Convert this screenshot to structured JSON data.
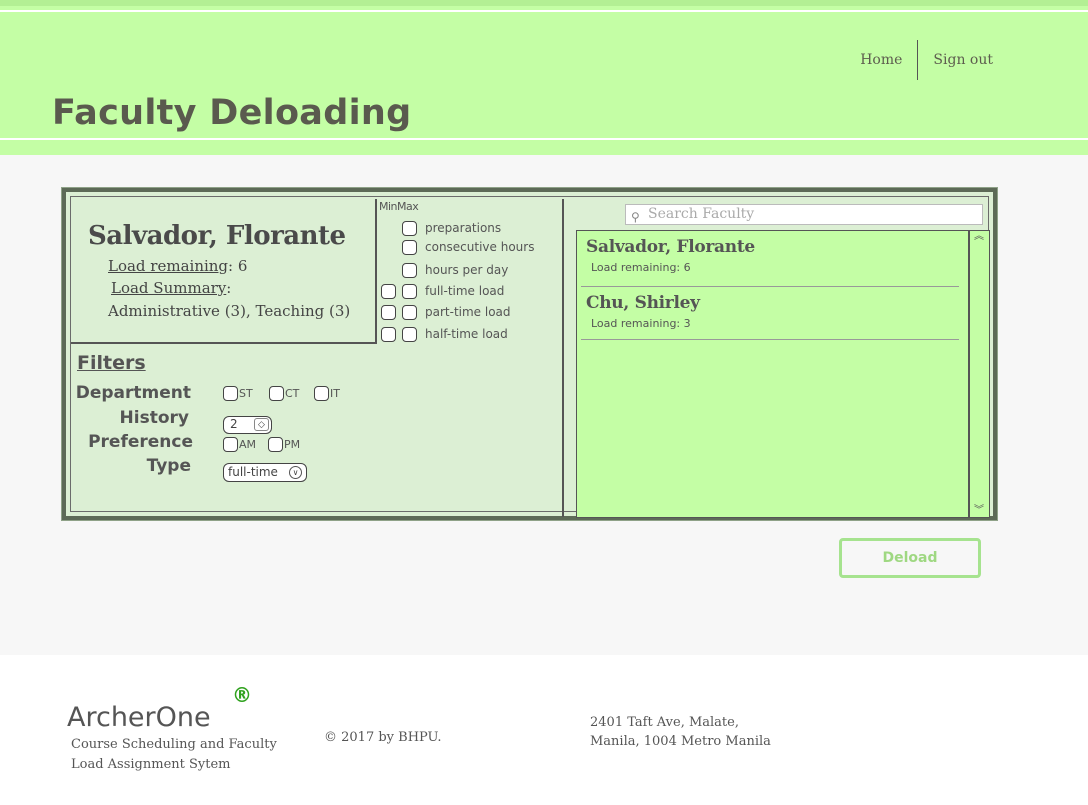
{
  "header": {
    "title": "Faculty Deloading",
    "nav": {
      "home": "Home",
      "signout": "Sign out"
    }
  },
  "faculty": {
    "name": "Salvador, Florante",
    "load_remaining_label": "Load remaining",
    "load_remaining_value": ": 6",
    "load_summary_label": "Load Summary",
    "load_summary_colon": ":",
    "load_summary_value": "Administrative (3), Teaching (3)"
  },
  "constraints": {
    "min_label": "Min",
    "max_label": "Max",
    "items": [
      {
        "label": "preparations",
        "has_min": false
      },
      {
        "label": "consecutive hours",
        "has_min": false
      },
      {
        "label": "hours per day",
        "has_min": false
      },
      {
        "label": "full-time load",
        "has_min": true
      },
      {
        "label": "part-time load",
        "has_min": true
      },
      {
        "label": "half-time load",
        "has_min": true
      }
    ]
  },
  "filters": {
    "title": "Filters",
    "department_label": "Department",
    "departments": [
      "ST",
      "CT",
      "IT"
    ],
    "history_label": "History",
    "history_value": "2",
    "preference_label": "Preference",
    "preferences": [
      "AM",
      "PM"
    ],
    "type_label": "Type",
    "type_value": "full-time"
  },
  "search": {
    "placeholder": "Search Faculty"
  },
  "faculty_list": [
    {
      "name": "Salvador, Florante",
      "load": "Load remaining: 6"
    },
    {
      "name": "Chu, Shirley",
      "load": "Load remaining: 3"
    }
  ],
  "actions": {
    "deload": "Deload"
  },
  "footer": {
    "brand": "ArcherOne",
    "reg": "®",
    "tagline": "Course Scheduling and Faculty Load Assignment Sytem",
    "copyright": "© 2017 by BHPU.",
    "address_line1": "2401 Taft Ave, Malate,",
    "address_line2": "Manila, 1004 Metro Manila"
  },
  "colors": {
    "accent": "#c4fea5",
    "panel": "#dcefd4",
    "button_text": "#9fd882",
    "reg": "#30a21f"
  },
  "icons": {
    "search": "search-icon",
    "stepper": "stepper-arrows-icon",
    "dropdown": "chevron-down-icon"
  }
}
